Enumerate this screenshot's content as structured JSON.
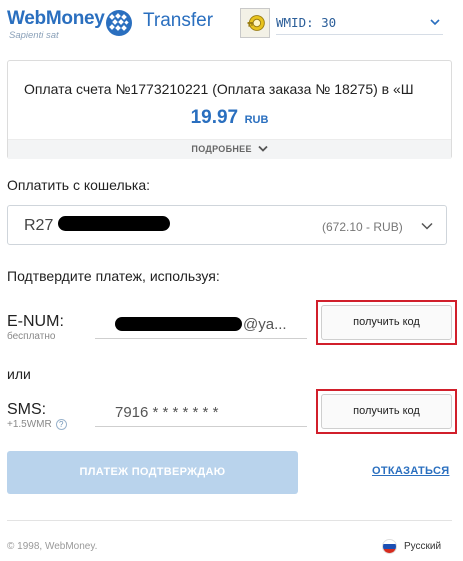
{
  "header": {
    "logo_name": "WebMoney",
    "logo_tagline": "Sapienti sat",
    "logo_product": "Transfer",
    "wmid_label": "WMID: 30"
  },
  "invoice": {
    "title": "Оплата счета №1773210221 (Оплата заказа № 18275) в «Ш",
    "amount": "19.97",
    "currency": "RUB",
    "more_label": "ПОДРОБНЕЕ"
  },
  "wallet": {
    "label": "Оплатить с кошелька:",
    "id_prefix": "R27",
    "balance": "(672.10 - RUB)"
  },
  "confirm_section": {
    "label": "Подтвердите платеж, используя:",
    "enum": {
      "title": "E-NUM:",
      "subtitle": "бесплатно",
      "email_domain": "@ya...",
      "button_label": "получить код"
    },
    "or_label": "или",
    "sms": {
      "title": "SMS:",
      "subtitle": "+1.5WMR",
      "help_glyph": "?",
      "phone_masked": "7916 * * * * * * *",
      "button_label": "получить код"
    }
  },
  "actions": {
    "confirm_label": "ПЛАТЕЖ ПОДТВЕРЖДАЮ",
    "cancel_label": "ОТКАЗАТЬСЯ"
  },
  "footer": {
    "copyright": "© 1998, WebMoney.",
    "language": "Русский"
  },
  "colors": {
    "brand_blue": "#2a6fbf",
    "highlight_red": "#d11f2b",
    "disabled_button": "#b9d3ec"
  }
}
